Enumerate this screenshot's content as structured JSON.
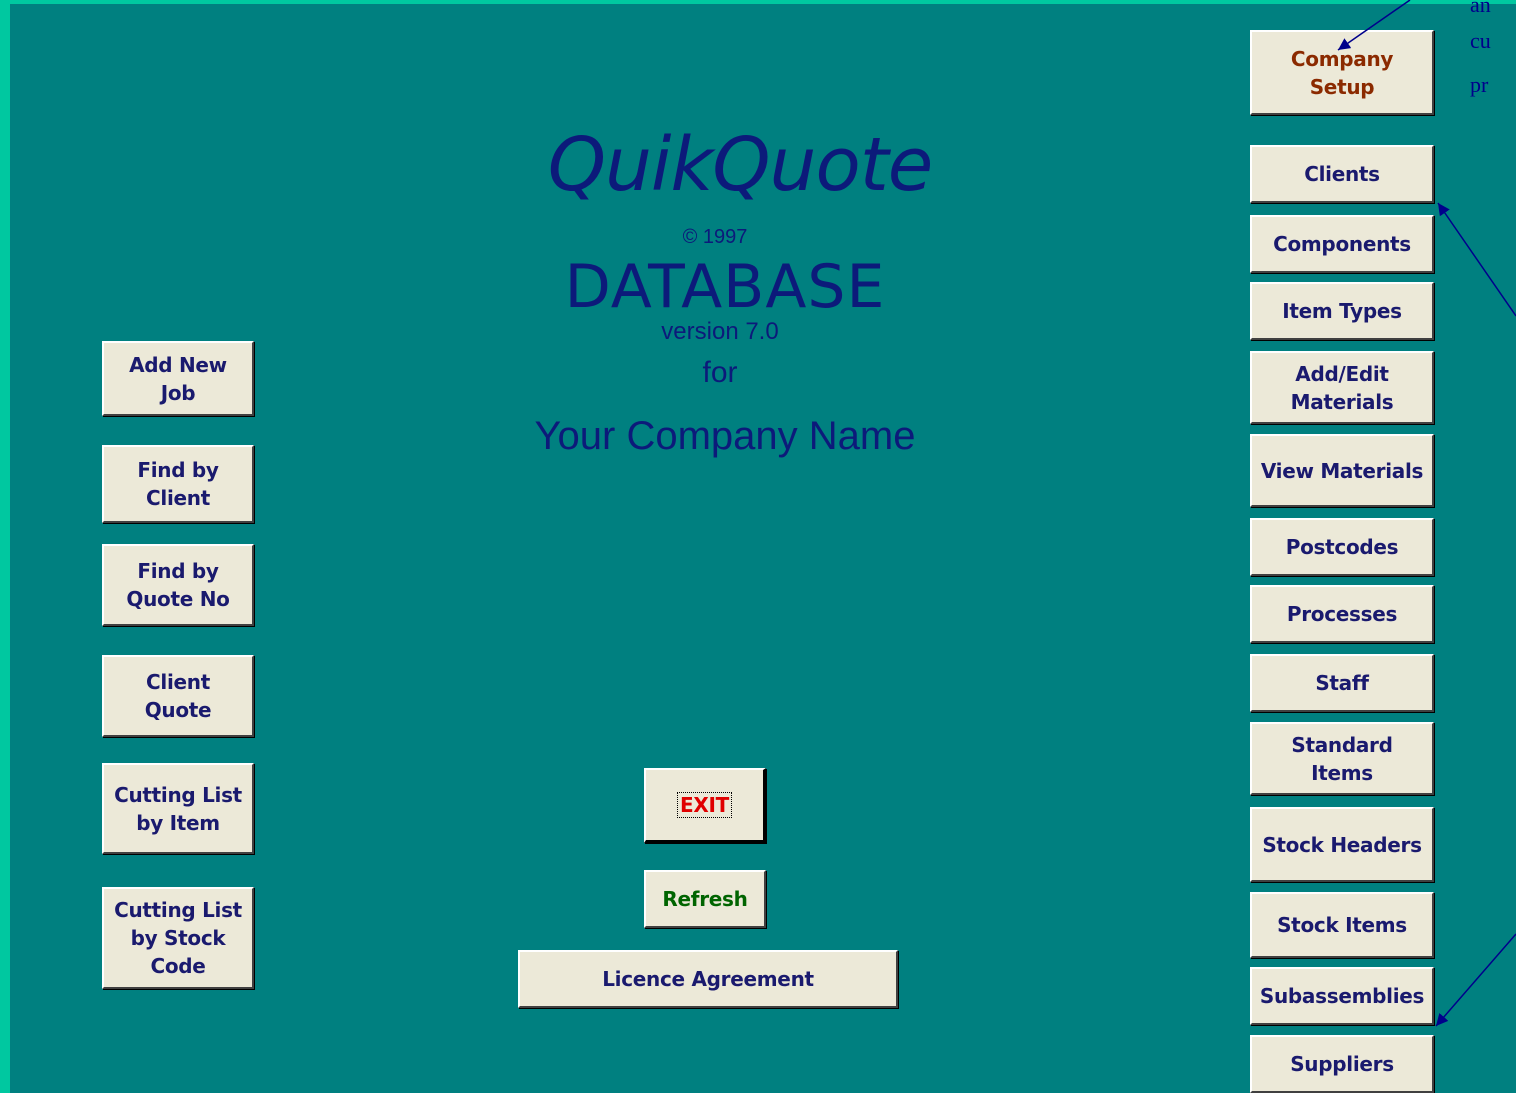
{
  "app": {
    "title": "QuikQuote",
    "copyright": "© 1997",
    "subtitle": "DATABASE",
    "version": "version 7.0",
    "for_text": "for",
    "company_name": "Your Company Name"
  },
  "left_buttons": {
    "add_new_job": "Add New\nJob",
    "find_by_client": "Find by\nClient",
    "find_by_quote": "Find by\nQuote No",
    "client_quote": "Client\nQuote",
    "cutting_by_item": "Cutting List\nby Item",
    "cutting_by_stock": "Cutting List\nby Stock\nCode"
  },
  "center_buttons": {
    "exit": "EXIT",
    "refresh": "Refresh",
    "licence": "Licence Agreement"
  },
  "right_buttons": {
    "company_setup": "Company\nSetup",
    "clients": "Clients",
    "components": "Components",
    "item_types": "Item Types",
    "add_edit_materials": "Add/Edit\nMaterials",
    "view_materials": "View Materials",
    "postcodes": "Postcodes",
    "processes": "Processes",
    "staff": "Staff",
    "standard_items": "Standard\nItems",
    "stock_headers": "Stock Headers",
    "stock_items": "Stock Items",
    "subassemblies": "Subassemblies",
    "suppliers": "Suppliers"
  },
  "annotation": {
    "line1": "an",
    "line2": "cu",
    "line3": "pr"
  },
  "colors": {
    "background": "#008080",
    "border_strip": "#00c8a0",
    "button_face": "#ece9d8",
    "button_text": "#1a1a6e",
    "company_setup_text": "#8b2a00",
    "exit_text": "#e00000",
    "refresh_text": "#006400",
    "logo_text": "#0c1a7a"
  }
}
